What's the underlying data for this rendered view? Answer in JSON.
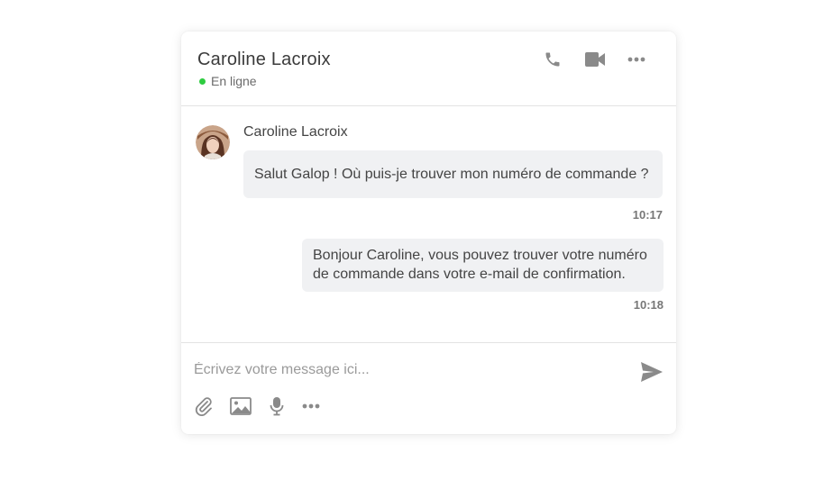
{
  "header": {
    "contact_name": "Caroline Lacroix",
    "status": "En ligne",
    "status_color": "#2ecc40",
    "actions": [
      "phone-icon",
      "video-camera-icon",
      "more-horizontal-icon"
    ]
  },
  "messages": [
    {
      "direction": "incoming",
      "sender": "Caroline Lacroix",
      "avatar": "avatar",
      "text": "Salut Galop ! Où puis-je trouver mon numéro de commande ?",
      "time": "10:17"
    },
    {
      "direction": "outgoing",
      "text": "Bonjour Caroline, vous pouvez trouver votre numéro de commande dans votre e-mail de confirmation.",
      "time": "10:18"
    }
  ],
  "composer": {
    "placeholder": "Écrivez votre message ici...",
    "value": "",
    "send_icon": "send-icon",
    "tools": [
      "paperclip-icon",
      "image-icon",
      "microphone-icon",
      "more-horizontal-icon"
    ]
  },
  "colors": {
    "bubble_background": "#f0f1f3",
    "icon_gray": "#8a8a8a"
  }
}
